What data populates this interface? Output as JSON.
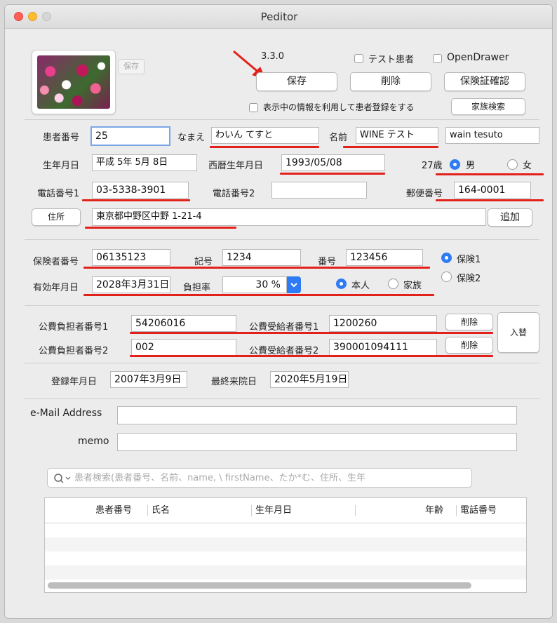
{
  "window": {
    "title": "Peditor"
  },
  "header": {
    "small_save": "保存",
    "version": "3.3.0",
    "test_patient": "テスト患者",
    "open_drawer": "OpenDrawer",
    "save": "保存",
    "delete": "削除",
    "insurance_check": "保険証確認",
    "register_from_display": "表示中の情報を利用して患者登録をする",
    "family_search": "家族検索"
  },
  "patient": {
    "id_label": "患者番号",
    "id": "25",
    "name_kana_label": "なまえ",
    "name_kana": "わいん てすと",
    "name_label": "名前",
    "name": "WINE テスト",
    "romaji": "wain tesuto",
    "birth_label": "生年月日",
    "birth_jp": "平成 5年 5月 8日",
    "birth_western_label": "西暦生年月日",
    "birth_western": "1993/05/08",
    "age": "27歳",
    "male": "男",
    "female": "女",
    "phone1_label": "電話番号1",
    "phone1": "03-5338-3901",
    "phone2_label": "電話番号2",
    "phone2": "",
    "postal_label": "郵便番号",
    "postal": "164-0001",
    "address_button": "住所",
    "address": "東京都中野区中野 1-21-4",
    "add_button": "追加"
  },
  "insurance": {
    "insurer_label": "保険者番号",
    "insurer": "06135123",
    "symbol_label": "記号",
    "symbol": "1234",
    "number_label": "番号",
    "number": "123456",
    "ins1": "保険1",
    "ins2": "保険2",
    "valid_label": "有効年月日",
    "valid": "2028年3月31日",
    "burden_label": "負担率",
    "burden": "30 %",
    "self": "本人",
    "family": "家族"
  },
  "public": {
    "payer1_label": "公費負担者番号1",
    "payer1": "54206016",
    "recipient1_label": "公費受給者番号1",
    "recipient1": "1200260",
    "payer2_label": "公費負担者番号2",
    "payer2": "002",
    "recipient2_label": "公費受給者番号2",
    "recipient2": "390001094111",
    "delete": "削除",
    "swap": "入替"
  },
  "dates": {
    "registered_label": "登録年月日",
    "registered": "2007年3月9日",
    "last_visit_label": "最終来院日",
    "last_visit": "2020年5月19日"
  },
  "contact": {
    "email_label": "e-Mail Address",
    "email": "",
    "memo_label": "memo",
    "memo": ""
  },
  "search": {
    "placeholder": "患者検索(患者番号、名前、name, \\ firstName、たか*む、住所、生年"
  },
  "table": {
    "columns": [
      "患者番号",
      "氏名",
      "生年月日",
      "年齢",
      "電話番号"
    ]
  },
  "colors": {
    "accent": "#2f7bf5",
    "underline": "#e3211b",
    "arrow": "#e3211b"
  }
}
